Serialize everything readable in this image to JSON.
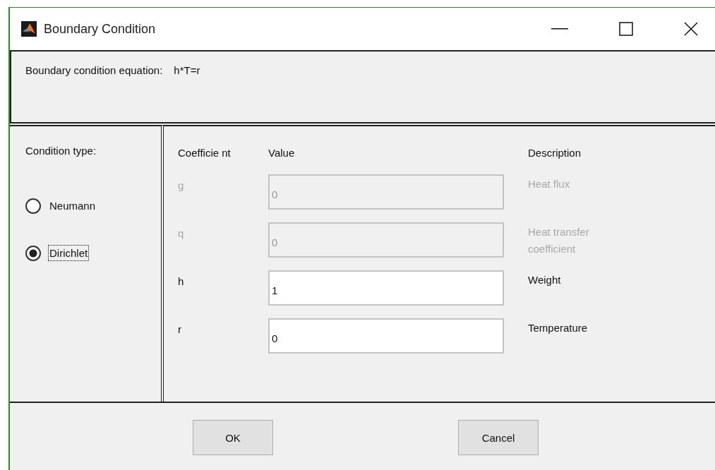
{
  "window": {
    "title": "Boundary Condition"
  },
  "equation": {
    "label": "Boundary condition equation:",
    "value": "h*T=r"
  },
  "condition_type": {
    "label": "Condition type:",
    "options": [
      {
        "label": "Neumann",
        "selected": false,
        "focused": false
      },
      {
        "label": "Dirichlet",
        "selected": true,
        "focused": true
      }
    ]
  },
  "table": {
    "columns": [
      "Coefficie nt",
      "Value",
      "Description"
    ],
    "rows": [
      {
        "coefficient": "g",
        "value": "0",
        "description": "Heat flux",
        "disabled": true
      },
      {
        "coefficient": "q",
        "value": "0",
        "description": "Heat transfer coefficient",
        "disabled": true
      },
      {
        "coefficient": "h",
        "value": "1",
        "description": "Weight",
        "disabled": false
      },
      {
        "coefficient": "r",
        "value": "0",
        "description": "Temperature",
        "disabled": false
      }
    ]
  },
  "buttons": [
    "OK",
    "Cancel"
  ]
}
